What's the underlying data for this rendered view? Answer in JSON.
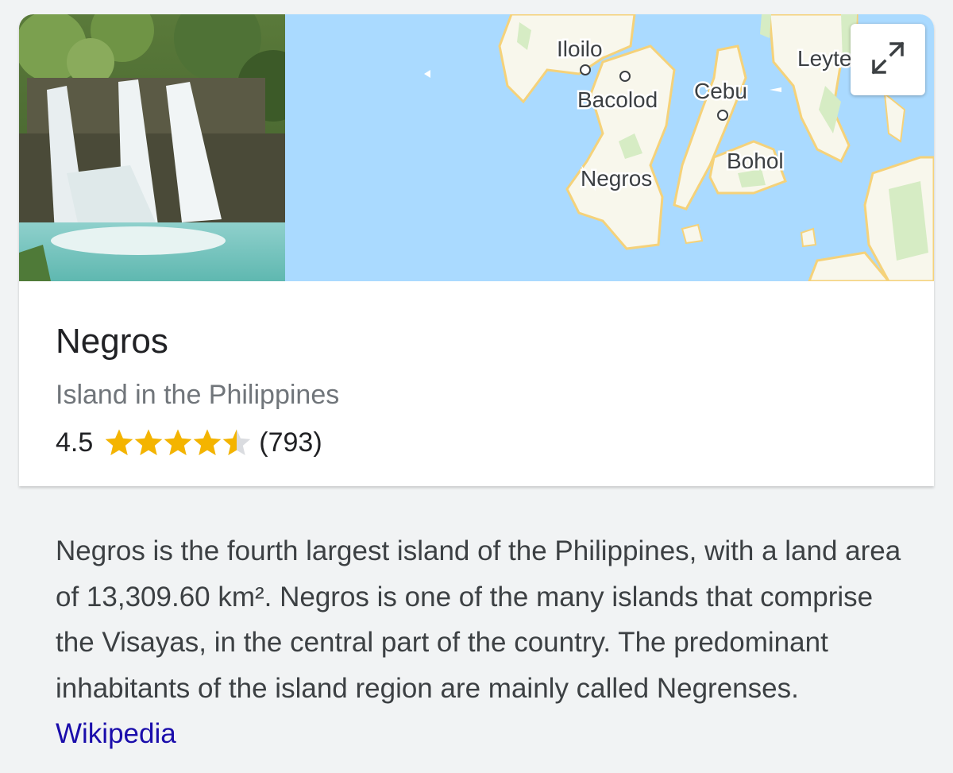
{
  "place": {
    "title": "Negros",
    "subtitle": "Island in the Philippines",
    "rating": "4.5",
    "rating_value": 4.5,
    "rating_max": 5,
    "review_count": "(793)"
  },
  "map": {
    "labels": {
      "iloilo": "Iloilo",
      "bacolod": "Bacolod",
      "cebu": "Cebu",
      "leyte": "Leyte",
      "negros": "Negros",
      "bohol": "Bohol"
    },
    "colors": {
      "water": "#aadaff",
      "land": "#f8f7ec",
      "coast": "#f5d27a",
      "park": "#d6ecc4"
    }
  },
  "description": {
    "text": "Negros is the fourth largest island of the Philippines, with a land area of 13,309.60 km². Negros is one of the many islands that comprise the Visayas, in the central part of the country. The predominant inhabitants of the island region are mainly called Negrenses.",
    "source_link": "Wikipedia"
  },
  "colors": {
    "star": "#f4b400",
    "star_empty": "#dadce0",
    "link": "#1a0dab",
    "text_primary": "#202124",
    "text_secondary": "#70757a"
  }
}
